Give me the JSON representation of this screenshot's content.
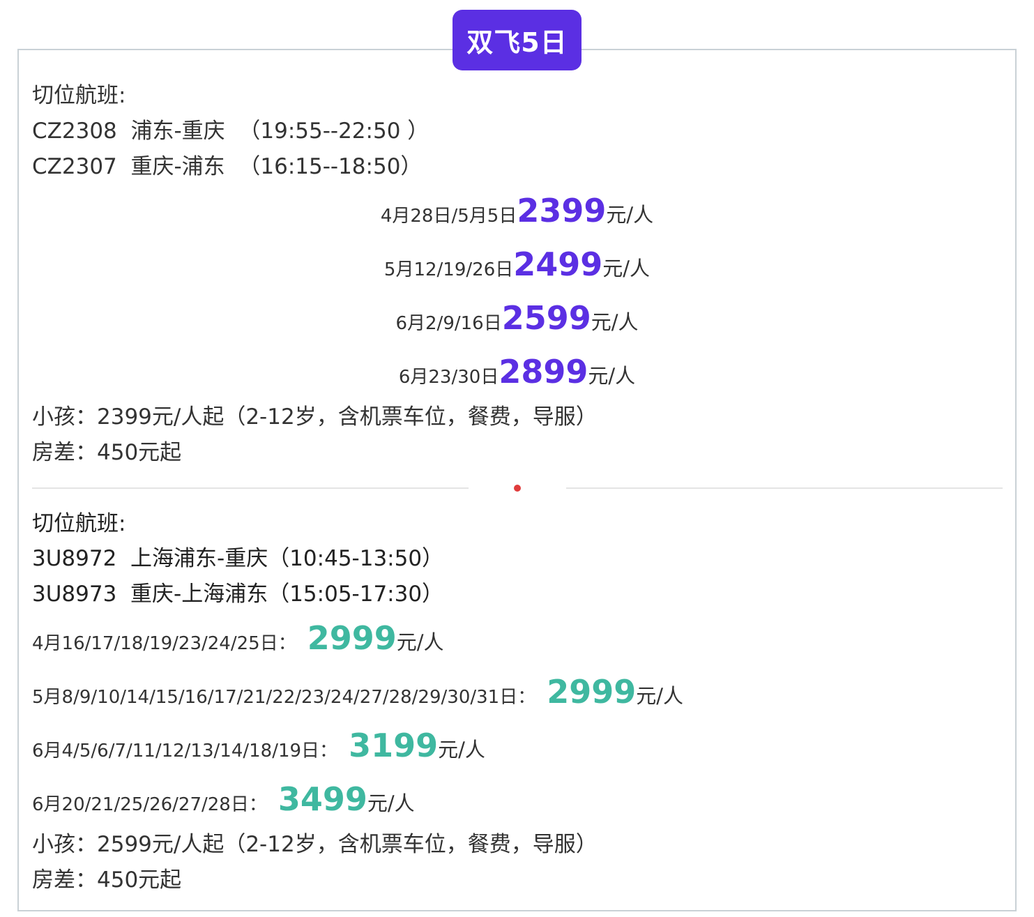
{
  "badge": "双飞5日",
  "section1": {
    "heading": "切位航班:",
    "flights": [
      "CZ2308  浦东-重庆  （19:55--22:50 ）",
      "CZ2307  重庆-浦东  （16:15--18:50）"
    ],
    "prices": [
      {
        "dates": "4月28日/5月5日",
        "price": "2399",
        "unit": "元/人"
      },
      {
        "dates": "5月12/19/26日",
        "price": "2499",
        "unit": "元/人"
      },
      {
        "dates": "6月2/9/16日",
        "price": "2599",
        "unit": "元/人"
      },
      {
        "dates": "6月23/30日",
        "price": "2899",
        "unit": "元/人"
      }
    ],
    "child": "小孩：2399元/人起（2-12岁，含机票车位，餐费，导服）",
    "room": "房差：450元起"
  },
  "section2": {
    "heading": "切位航班:",
    "flights": [
      "3U8972  上海浦东-重庆（10:45-13:50）",
      "3U8973  重庆-上海浦东（15:05-17:30）"
    ],
    "prices": [
      {
        "dates": "4月16/17/18/19/23/24/25日：",
        "price": "2999",
        "unit": "元/人"
      },
      {
        "dates": "5月8/9/10/14/15/16/17/21/22/23/24/27/28/29/30/31日：",
        "price": "2999",
        "unit": "元/人"
      },
      {
        "dates": "6月4/5/6/7/11/12/13/14/18/19日：",
        "price": "3199",
        "unit": "元/人"
      },
      {
        "dates": "6月20/21/25/26/27/28日：",
        "price": "3499",
        "unit": "元/人"
      }
    ],
    "child": "小孩：2599元/人起（2-12岁，含机票车位，餐费，导服）",
    "room": "房差：450元起"
  },
  "colors": {
    "accent_purple": "#5b2fe3",
    "accent_teal": "#3fb8a0",
    "divider_dot": "#e03c3c",
    "border": "#c9d1d6"
  }
}
